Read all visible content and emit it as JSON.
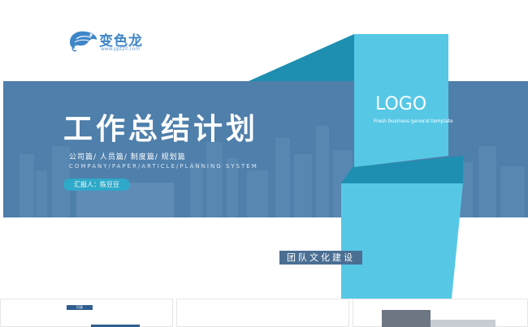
{
  "brand": {
    "name": "变色龙",
    "url": "www.ppt20.com",
    "logo_icon": "chameleon-icon",
    "color": "#3f86c8"
  },
  "slide": {
    "title": "工作总结计划",
    "subtitle": "公司篇/  人员篇/  制度篇/  规划篇",
    "subtitle_en": "COMPANY/PAPER/ARTICLE/PLANNING SYSTEM",
    "reporter": "汇报人：陈豆豆",
    "logo_word": "LOGO",
    "logo_sub": "Fresh business general template",
    "team_label": "团队文化建设"
  },
  "thumbnails": {
    "first_tag": "目录"
  },
  "colors": {
    "banner": "#4f7fab",
    "ribbon_light": "#56c8e6",
    "ribbon_dark": "#1e8fb0",
    "accent": "#2fa9c9"
  }
}
